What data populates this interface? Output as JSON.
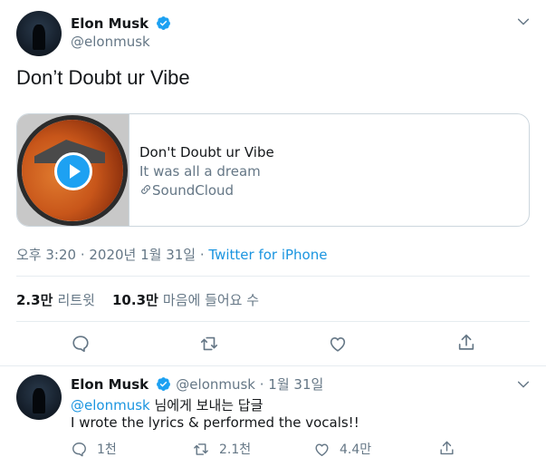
{
  "tweet": {
    "author_name": "Elon Musk",
    "author_handle": "@elonmusk",
    "text": "Don’t Doubt ur Vibe",
    "card": {
      "title": "Don't Doubt ur Vibe",
      "subtitle": "It was all a dream",
      "source": "SoundCloud"
    },
    "meta": {
      "time": "오후 3:20 · 2020년 1월 31일 · ",
      "client": "Twitter for iPhone"
    },
    "stats": {
      "retweets_count": "2.3만",
      "retweets_label": "리트윗",
      "likes_count": "10.3만",
      "likes_label": "마음에 들어요 수"
    }
  },
  "reply": {
    "author_name": "Elon Musk",
    "author_handle_date": "@elonmusk · 1월 31일",
    "replying_to_handle": "@elonmusk",
    "replying_to_suffix": " 님에게 보내는 답글",
    "text": "I wrote the lyrics & performed the vocals!!",
    "counts": {
      "replies": "1천",
      "retweets": "2.1천",
      "likes": "4.4만"
    }
  },
  "icons": {
    "verified": "verified-badge-icon",
    "more": "chevron-down-icon",
    "reply": "reply-icon",
    "retweet": "retweet-icon",
    "like": "heart-icon",
    "share": "share-icon",
    "link": "link-icon",
    "play": "play-icon"
  },
  "colors": {
    "accent": "#1da1f2",
    "link": "#1b95e0",
    "muted": "#657786",
    "border": "#ccd6dd"
  }
}
